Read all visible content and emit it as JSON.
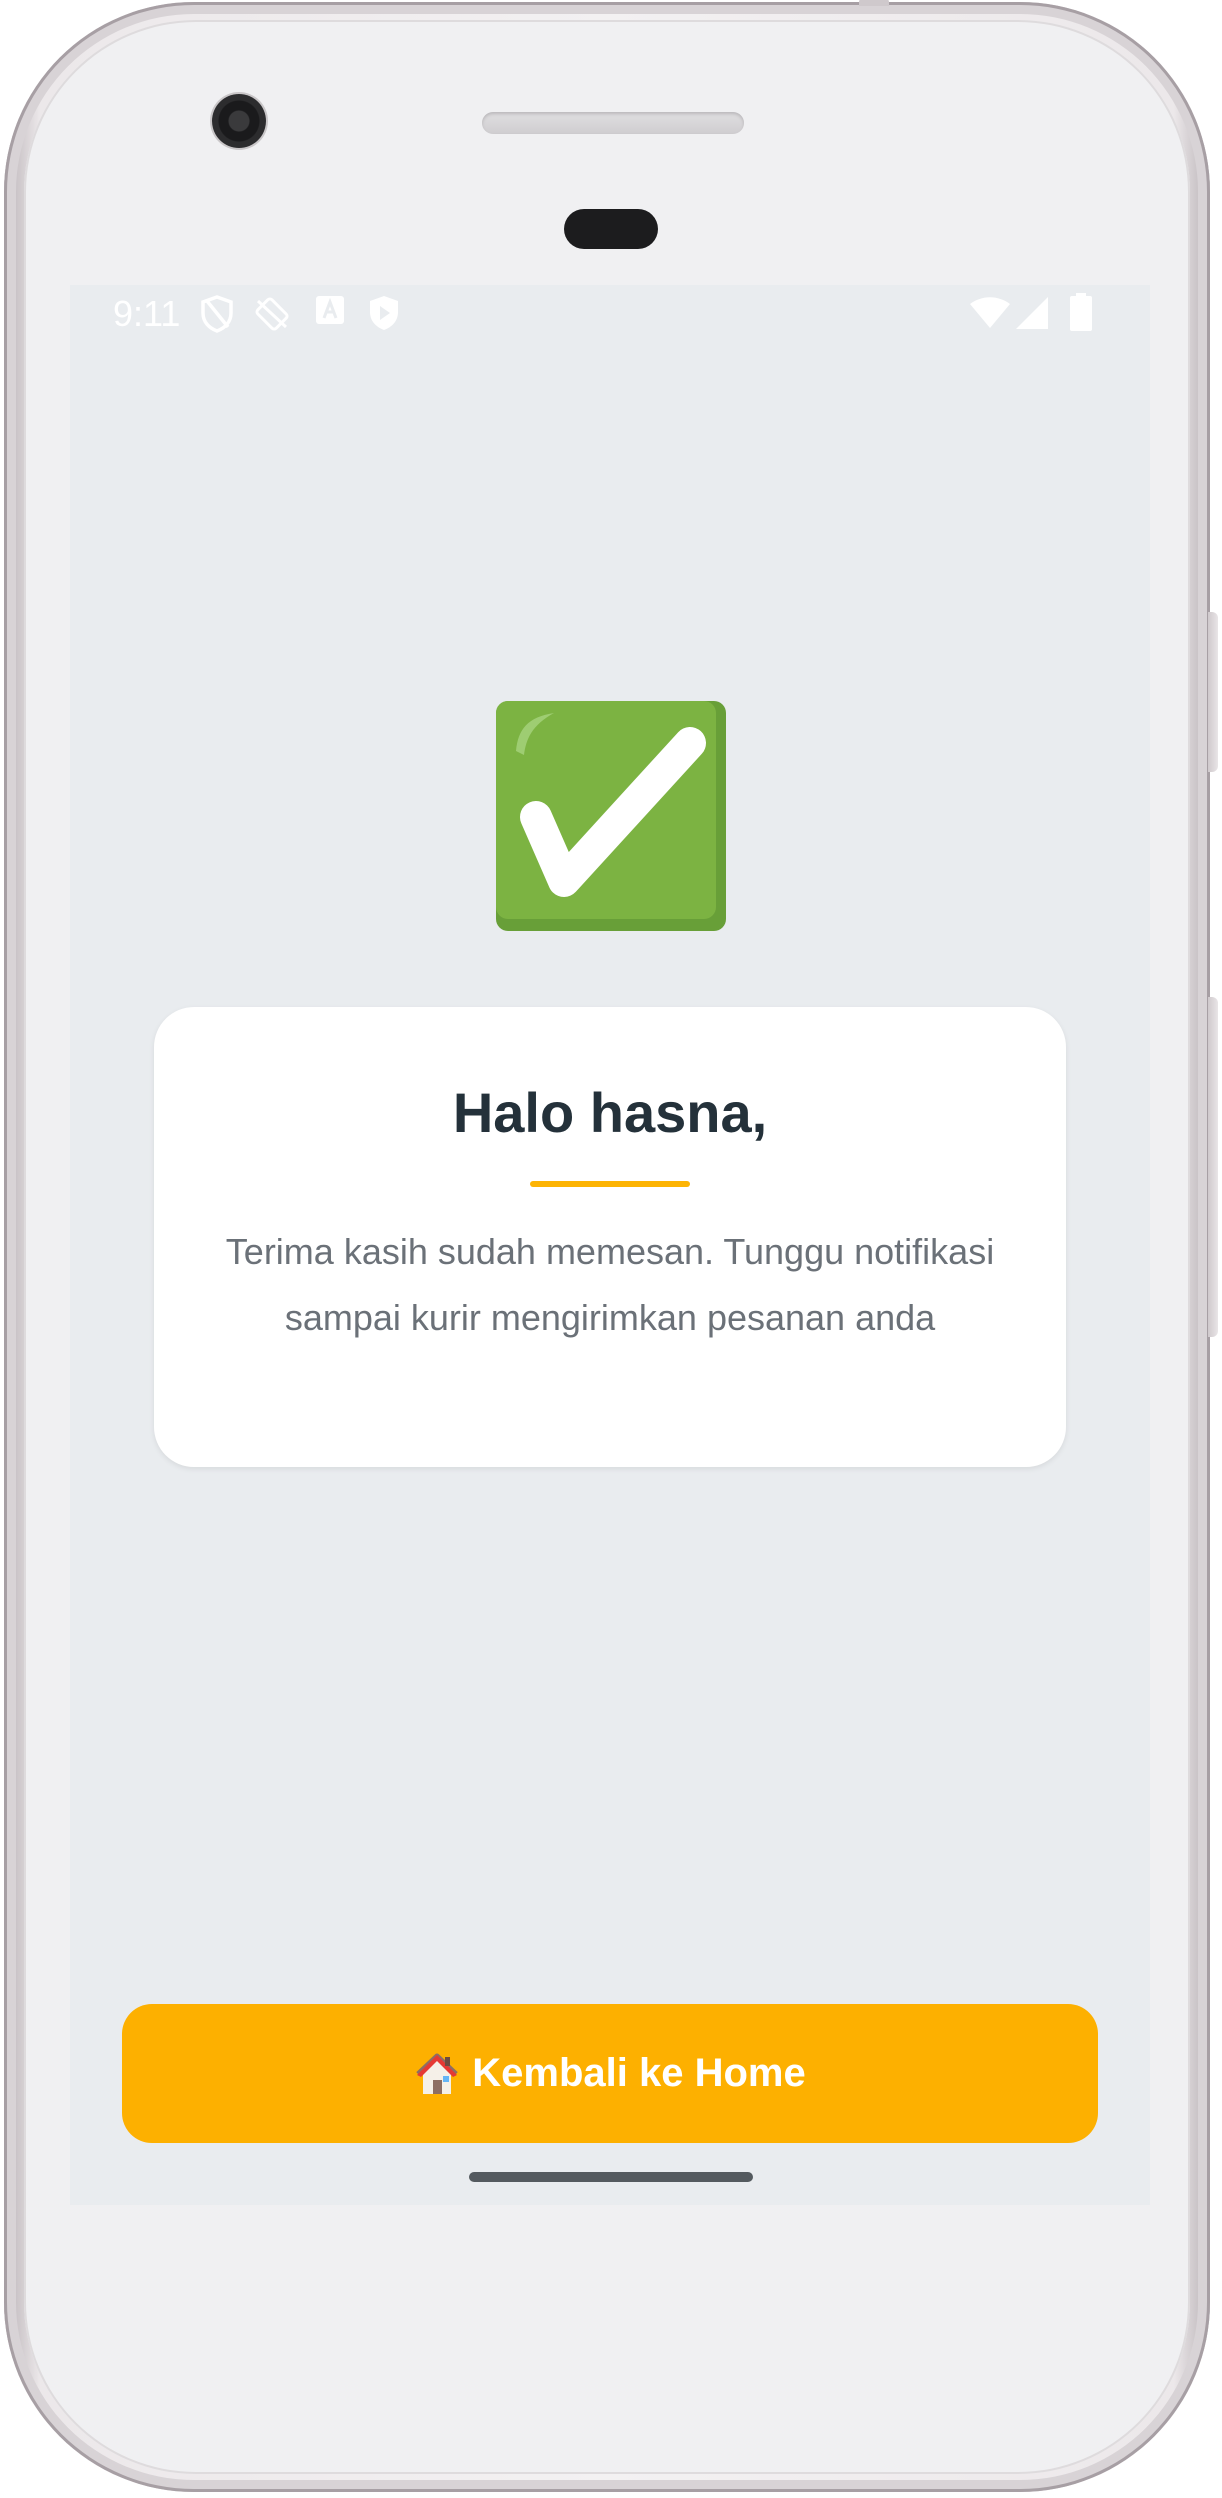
{
  "status_bar": {
    "time": "9:11",
    "left_icons": [
      "shield-icon",
      "sync-off-icon",
      "font-a-icon",
      "play-protect-icon"
    ],
    "right_icons": [
      "wifi-icon",
      "signal-icon",
      "battery-icon"
    ]
  },
  "success_icon": "check-mark-button-icon",
  "card": {
    "greeting": "Halo hasna,",
    "message": "Terima kasih sudah memesan. Tunggu notifikasi sampai kurir mengirimkan pesanan anda"
  },
  "home_button": {
    "icon": "house-icon",
    "label": "Kembali ke Home"
  },
  "colors": {
    "screen_background": "#e9ecef",
    "accent": "#fdb000",
    "check_green": "#7cb342",
    "title_text": "#24313a",
    "body_text": "#6b7178"
  }
}
